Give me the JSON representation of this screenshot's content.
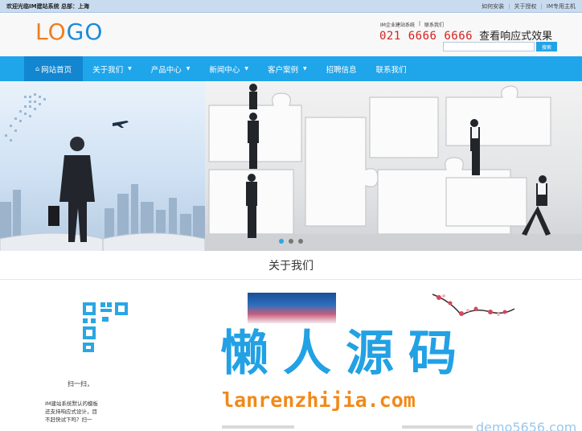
{
  "topbar": {
    "welcome": "欢迎光临IM建站系统 总部：上海",
    "links": [
      "如何安装",
      "关于授权",
      "IM专用主机"
    ]
  },
  "header": {
    "logo_part1": "LO",
    "logo_part2": "GO",
    "hotline_links": [
      "IM企业建站系统",
      "|",
      "联系我们"
    ],
    "phone": "021 6666 6666",
    "slogan": "查看响应式效果",
    "search_placeholder": "",
    "search_button": "搜索"
  },
  "nav": {
    "items": [
      {
        "label": "网站首页",
        "active": true
      },
      {
        "label": "关于我们",
        "dropdown": true
      },
      {
        "label": "产品中心",
        "dropdown": true
      },
      {
        "label": "新闻中心",
        "dropdown": true
      },
      {
        "label": "客户案例",
        "dropdown": true
      },
      {
        "label": "招聘信息"
      },
      {
        "label": "联系我们"
      }
    ]
  },
  "banner": {
    "slides": 3,
    "active_slide": 1
  },
  "about": {
    "title": "关于我们",
    "qr_caption": "扫一扫，",
    "text_lines": [
      "IM建站系统默认的模板",
      "还支持响应式设计，目",
      "不赶快试下吗？扫一"
    ]
  },
  "watermark": {
    "big": "懒人源码",
    "url": "lanrenzhijia.com",
    "demo": "demo5656.com"
  },
  "colors": {
    "brand_blue": "#1fa5ea",
    "nav_active": "#1286d0",
    "phone_red": "#d6211f",
    "logo_orange": "#ee7f1e"
  }
}
